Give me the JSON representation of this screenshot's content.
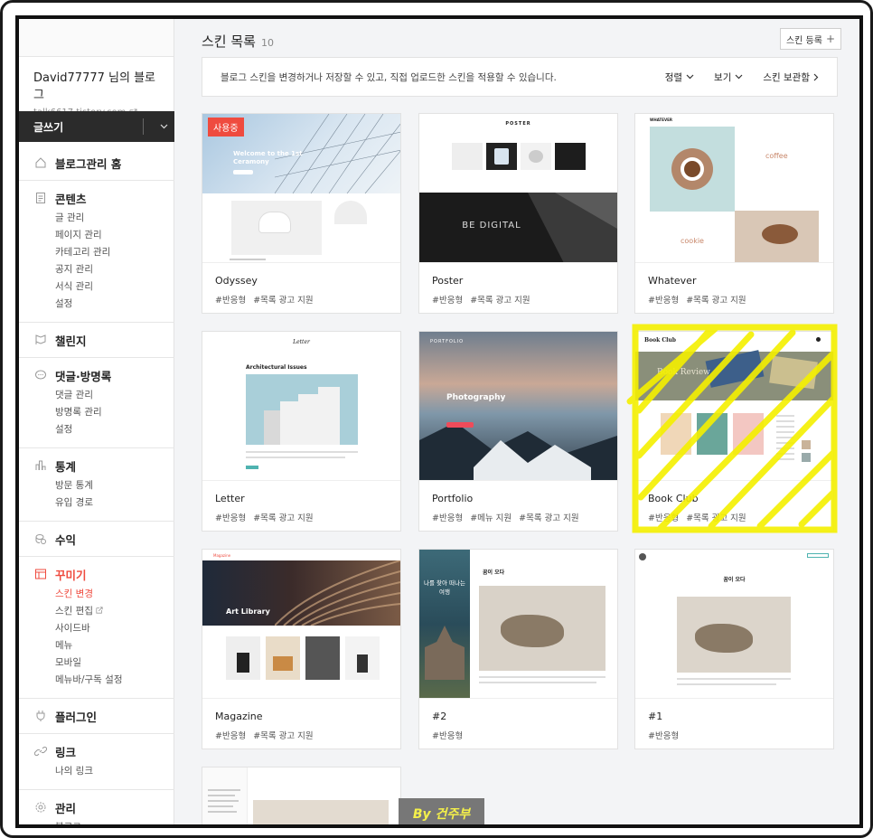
{
  "sidebar": {
    "blog_name": "David77777 님의 블로그",
    "blog_url": "talk6617.tistory.com",
    "write_label": "글쓰기",
    "sections": [
      {
        "icon": "home-icon",
        "label": "블로그관리 홈",
        "subs": []
      },
      {
        "icon": "document-icon",
        "label": "콘텐츠",
        "subs": [
          "글 관리",
          "페이지 관리",
          "카테고리 관리",
          "공지 관리",
          "서식 관리",
          "설정"
        ]
      },
      {
        "icon": "flag-icon",
        "label": "챌린지",
        "subs": []
      },
      {
        "icon": "comment-icon",
        "label": "댓글·방명록",
        "subs": [
          "댓글 관리",
          "방명록 관리",
          "설정"
        ]
      },
      {
        "icon": "bar-chart-icon",
        "label": "통계",
        "subs": [
          "방문 통계",
          "유입 경로"
        ]
      },
      {
        "icon": "coin-icon",
        "label": "수익",
        "subs": []
      },
      {
        "icon": "layout-icon",
        "label": "꾸미기",
        "active": true,
        "subs": [
          "스킨 변경",
          "스킨 편집",
          "사이드바",
          "메뉴",
          "모바일",
          "메뉴바/구독 설정"
        ]
      },
      {
        "icon": "plug-icon",
        "label": "플러그인",
        "subs": []
      },
      {
        "icon": "link-icon",
        "label": "링크",
        "subs": [
          "나의 링크"
        ]
      },
      {
        "icon": "gear-icon",
        "label": "관리",
        "subs": [
          "블로그"
        ]
      }
    ]
  },
  "main": {
    "title": "스킨 목록",
    "count": "10",
    "register_label": "스킨 등록",
    "info_text": "블로그 스킨을 변경하거나 저장할 수 있고, 직접 업로드한 스킨을 적용할 수 있습니다.",
    "sort_label": "정렬",
    "view_label": "보기",
    "storage_label": "스킨 보관함"
  },
  "skins": [
    {
      "name": "Odyssey",
      "tags": [
        "#반응형",
        "#목록 광고 지원"
      ],
      "badge": "사용중",
      "thumb_text": "Welcome to the 1st Ceramony"
    },
    {
      "name": "Poster",
      "tags": [
        "#반응형",
        "#목록 광고 지원"
      ],
      "thumb_text": "BE DIGITAL",
      "thumb_logo": "POSTER"
    },
    {
      "name": "Whatever",
      "tags": [
        "#반응형",
        "#목록 광고 지원"
      ],
      "thumb_text": "coffee",
      "thumb_text2": "cookie",
      "thumb_logo": "WHATEVER"
    },
    {
      "name": "Letter",
      "tags": [
        "#반응형",
        "#목록 광고 지원"
      ],
      "thumb_text": "Architectural Issues",
      "thumb_logo": "Letter"
    },
    {
      "name": "Portfolio",
      "tags": [
        "#반응형",
        "#메뉴 지원",
        "#목록 광고 지원"
      ],
      "thumb_text": "Photography",
      "thumb_logo": "PORTFOLIO"
    },
    {
      "name": "Book Club",
      "tags": [
        "#반응형",
        "#목록 광고 지원"
      ],
      "thumb_text": "Book Review",
      "thumb_logo": "Book Club"
    },
    {
      "name": "Magazine",
      "tags": [
        "#반응형",
        "#목록 광고 지원"
      ],
      "thumb_text": "Art Library",
      "thumb_logo": "Magazine"
    },
    {
      "name": "#2",
      "tags": [
        "#반응형"
      ],
      "thumb_text": "나를 찾아 떠나는 여행",
      "thumb_text2": "꿈이 오다"
    },
    {
      "name": "#1",
      "tags": [
        "#반응형"
      ],
      "thumb_text": "꿈이 오다"
    }
  ],
  "watermark": "By 건주부",
  "colors": {
    "accent": "#ef4b3f",
    "dark": "#2b2b2b",
    "highlight": "#f5f000"
  }
}
